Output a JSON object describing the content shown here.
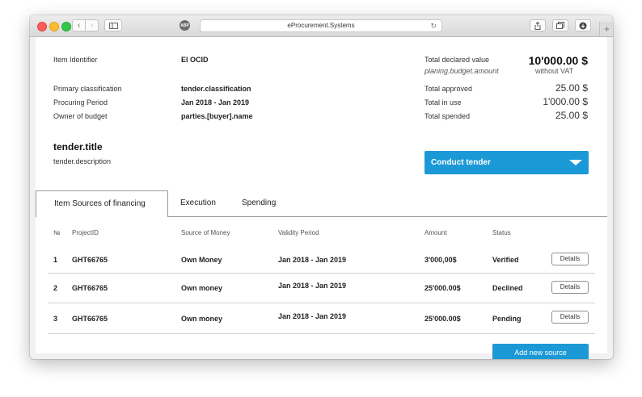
{
  "browser": {
    "url": "eProcurement.Systems",
    "extension_label": "ABP"
  },
  "info": {
    "item_identifier_label": "Item Identifier",
    "item_identifier_value": "EI OCID",
    "primary_classification_label": "Primary classification",
    "primary_classification_value": "tender.classification",
    "procuring_period_label": "Procuring Period",
    "procuring_period_value": "Jan 2018 - Jan 2019",
    "owner_label": "Owner of budget",
    "owner_value": "parties.[buyer].name"
  },
  "summary": {
    "total_declared_label": "Total declared value",
    "total_declared_sub": "planing.budget.amount",
    "total_declared_value": "10'000.00 $",
    "without_vat": "without VAT",
    "approved_label": "Total approved",
    "approved_value": "25.00 $",
    "in_use_label": "Total in use",
    "in_use_value": "1'000.00 $",
    "spended_label": "Total spended",
    "spended_value": "25.00 $"
  },
  "tender": {
    "title": "tender.title",
    "description": "tender.description",
    "conduct_label": "Conduct tender"
  },
  "tabs": [
    {
      "label": "Item Sources of financing"
    },
    {
      "label": "Execution"
    },
    {
      "label": "Spending"
    }
  ],
  "table": {
    "headers": [
      "№",
      "ProjectID",
      "Source of Money",
      "Validity Period",
      "Amount",
      "Status"
    ],
    "rows": [
      {
        "no": "1",
        "project_id": "GHT66765",
        "source": "Own Money",
        "period": "Jan 2018 - Jan 2019",
        "amount": "3'000,00$",
        "status": "Verified",
        "action": "Details"
      },
      {
        "no": "2",
        "project_id": "GHT66765",
        "source": "Own money",
        "period": "Jan 2018 - Jan 2019",
        "amount": "25'000.00$",
        "status": "Declined",
        "action": "Details"
      },
      {
        "no": "3",
        "project_id": "GHT66765",
        "source": "Own money",
        "period": "Jan 2018 - Jan 2019",
        "amount": "25'000.00$",
        "status": "Pending",
        "action": "Details"
      }
    ],
    "add_label": "Add new source"
  },
  "colors": {
    "accent": "#1b99d6"
  }
}
